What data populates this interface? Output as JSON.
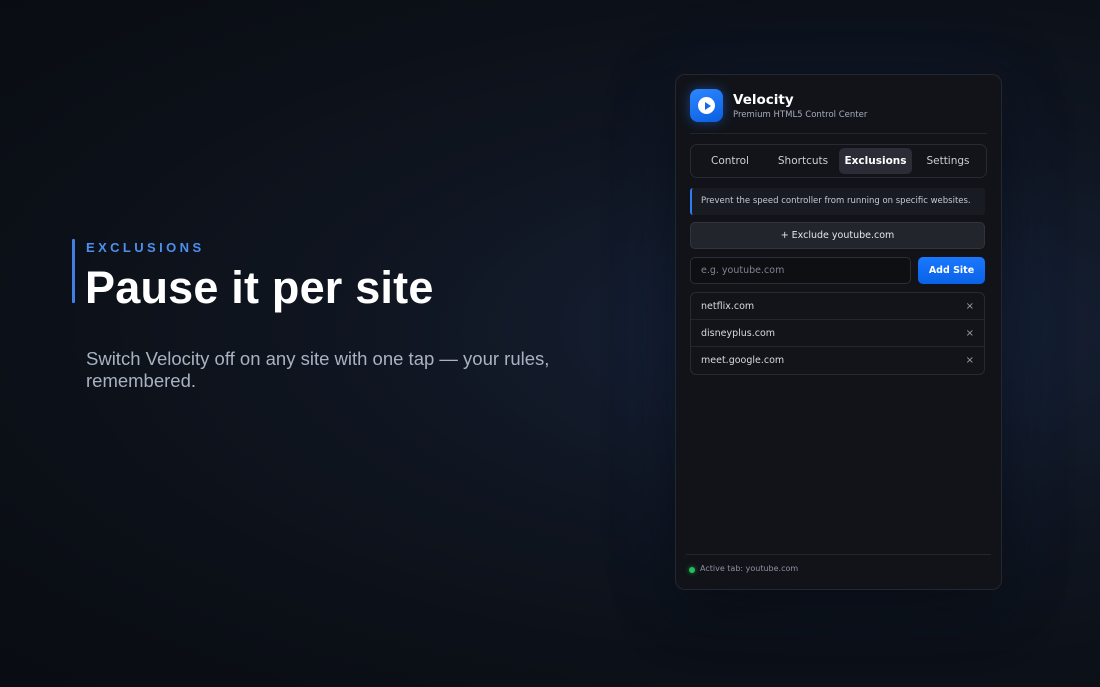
{
  "hero": {
    "eyebrow": "EXCLUSIONS",
    "headline": "Pause it per site",
    "subtext": "Switch Velocity off on any site with one tap — your rules, remembered."
  },
  "app": {
    "title": "Velocity",
    "subtitle": "Premium HTML5 Control Center",
    "accent_color": "#1a78ff"
  },
  "tabs": [
    {
      "label": "Control",
      "active": false
    },
    {
      "label": "Shortcuts",
      "active": false
    },
    {
      "label": "Exclusions",
      "active": true
    },
    {
      "label": "Settings",
      "active": false
    }
  ],
  "exclusions": {
    "info_text": "Prevent the speed controller from running on specific websites.",
    "exclude_current_label": "+ Exclude youtube.com",
    "input_placeholder": "e.g. youtube.com",
    "input_value": "",
    "add_button_label": "Add Site",
    "remove_icon": "×",
    "sites": [
      "netflix.com",
      "disneyplus.com",
      "meet.google.com"
    ]
  },
  "footer": {
    "status_text": "Active tab: youtube.com",
    "status_color": "#21c05c"
  }
}
